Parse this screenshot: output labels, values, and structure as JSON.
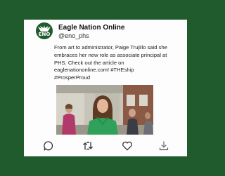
{
  "post": {
    "account_name": "Eagle Nation Online",
    "handle": "@eno_phs",
    "avatar_mark": "ENO",
    "text_lines": [
      "From art to administrator, Paige Trujillo said she",
      "embraces her new role as associate principal at",
      "PHS. Check out the article on",
      "eaglenationonline.com! #THEship",
      "#ProsperProud"
    ]
  },
  "actions": [
    {
      "icon": "comment-icon"
    },
    {
      "icon": "repost-icon"
    },
    {
      "icon": "heart-icon"
    },
    {
      "icon": "share-icon"
    }
  ],
  "colors": {
    "background": "#1f5b2d",
    "card": "#fdfdfd",
    "icon": "#333333"
  }
}
